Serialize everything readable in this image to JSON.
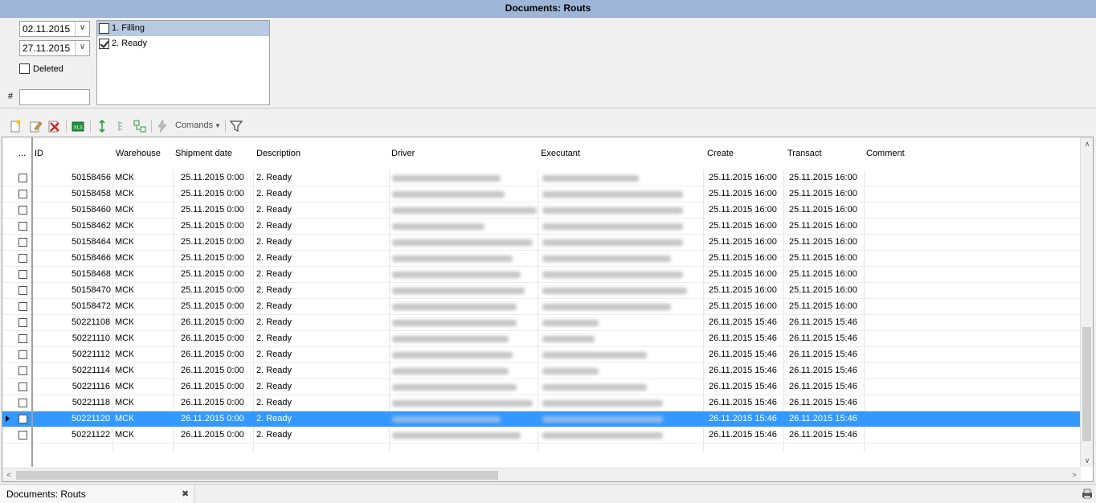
{
  "window": {
    "title": "Documents: Routs"
  },
  "filters": {
    "date_from": "02.11.2015",
    "date_to": "27.11.2015",
    "deleted_label": "Deleted",
    "number_label": "#",
    "number_value": "",
    "statuses": [
      {
        "label": "1. Filling",
        "checked": false
      },
      {
        "label": "2. Ready",
        "checked": true
      }
    ]
  },
  "toolbar": {
    "commands_label": "Comands"
  },
  "table": {
    "columns": [
      "...",
      "ID",
      "Warehouse",
      "Shipment date",
      "Description",
      "Driver",
      "Executant",
      "Create",
      "Transact",
      "Comment"
    ],
    "rows": [
      {
        "id": "50158456",
        "warehouse": "МСК",
        "shipment": "25.11.2015 0:00",
        "description": "2. Ready",
        "create": "25.11.2015 16:00",
        "transact": "25.11.2015 16:00"
      },
      {
        "id": "50158458",
        "warehouse": "МСК",
        "shipment": "25.11.2015 0:00",
        "description": "2. Ready",
        "create": "25.11.2015 16:00",
        "transact": "25.11.2015 16:00"
      },
      {
        "id": "50158460",
        "warehouse": "МСК",
        "shipment": "25.11.2015 0:00",
        "description": "2. Ready",
        "create": "25.11.2015 16:00",
        "transact": "25.11.2015 16:00"
      },
      {
        "id": "50158462",
        "warehouse": "МСК",
        "shipment": "25.11.2015 0:00",
        "description": "2. Ready",
        "create": "25.11.2015 16:00",
        "transact": "25.11.2015 16:00"
      },
      {
        "id": "50158464",
        "warehouse": "МСК",
        "shipment": "25.11.2015 0:00",
        "description": "2. Ready",
        "create": "25.11.2015 16:00",
        "transact": "25.11.2015 16:00"
      },
      {
        "id": "50158466",
        "warehouse": "МСК",
        "shipment": "25.11.2015 0:00",
        "description": "2. Ready",
        "create": "25.11.2015 16:00",
        "transact": "25.11.2015 16:00"
      },
      {
        "id": "50158468",
        "warehouse": "МСК",
        "shipment": "25.11.2015 0:00",
        "description": "2. Ready",
        "create": "25.11.2015 16:00",
        "transact": "25.11.2015 16:00"
      },
      {
        "id": "50158470",
        "warehouse": "МСК",
        "shipment": "25.11.2015 0:00",
        "description": "2. Ready",
        "create": "25.11.2015 16:00",
        "transact": "25.11.2015 16:00"
      },
      {
        "id": "50158472",
        "warehouse": "МСК",
        "shipment": "25.11.2015 0:00",
        "description": "2. Ready",
        "create": "25.11.2015 16:00",
        "transact": "25.11.2015 16:00"
      },
      {
        "id": "50221108",
        "warehouse": "МСК",
        "shipment": "26.11.2015 0:00",
        "description": "2. Ready",
        "create": "26.11.2015 15:46",
        "transact": "26.11.2015 15:46"
      },
      {
        "id": "50221110",
        "warehouse": "МСК",
        "shipment": "26.11.2015 0:00",
        "description": "2. Ready",
        "create": "26.11.2015 15:46",
        "transact": "26.11.2015 15:46"
      },
      {
        "id": "50221112",
        "warehouse": "МСК",
        "shipment": "26.11.2015 0:00",
        "description": "2. Ready",
        "create": "26.11.2015 15:46",
        "transact": "26.11.2015 15:46"
      },
      {
        "id": "50221114",
        "warehouse": "МСК",
        "shipment": "26.11.2015 0:00",
        "description": "2. Ready",
        "create": "26.11.2015 15:46",
        "transact": "26.11.2015 15:46"
      },
      {
        "id": "50221116",
        "warehouse": "МСК",
        "shipment": "26.11.2015 0:00",
        "description": "2. Ready",
        "create": "26.11.2015 15:46",
        "transact": "26.11.2015 15:46"
      },
      {
        "id": "50221118",
        "warehouse": "МСК",
        "shipment": "26.11.2015 0:00",
        "description": "2. Ready",
        "create": "26.11.2015 15:46",
        "transact": "26.11.2015 15:46"
      },
      {
        "id": "50221120",
        "warehouse": "МСК",
        "shipment": "26.11.2015 0:00",
        "description": "2. Ready",
        "create": "26.11.2015 15:46",
        "transact": "26.11.2015 15:46",
        "selected": true
      },
      {
        "id": "50221122",
        "warehouse": "МСК",
        "shipment": "26.11.2015 0:00",
        "description": "2. Ready",
        "create": "26.11.2015 15:46",
        "transact": "26.11.2015 15:46"
      }
    ]
  },
  "tabbar": {
    "tab_label": "Documents: Routs",
    "close_glyph": "✖"
  },
  "colors": {
    "titlebar": "#9db5d6",
    "selection": "#3399ff",
    "status_highlight": "#b8c9e2"
  }
}
